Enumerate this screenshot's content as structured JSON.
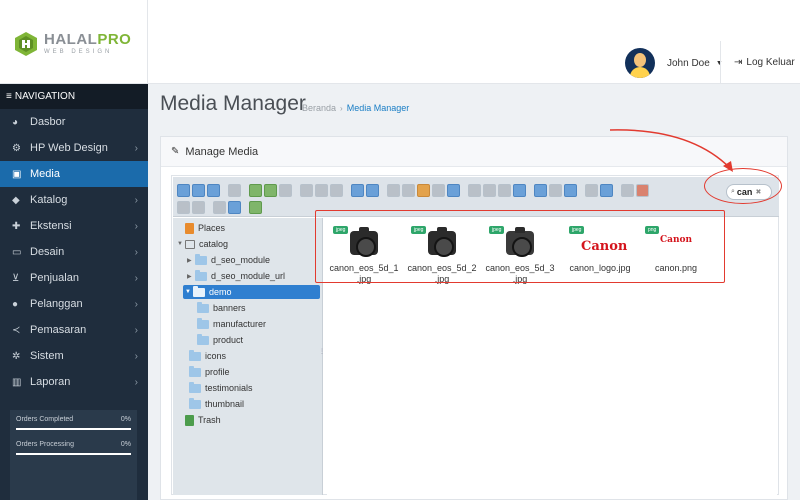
{
  "brand": {
    "name_part1": "HALAL",
    "name_part2": "PRO",
    "tagline": "WEB DESIGN"
  },
  "user": {
    "name": "John Doe",
    "logout_label": "Log Keluar"
  },
  "sidebar": {
    "header": "NAVIGATION",
    "items": [
      {
        "label": "Dasbor",
        "icon": "dashboard-icon",
        "chevron": false
      },
      {
        "label": "HP Web Design",
        "icon": "cogs-icon",
        "chevron": true
      },
      {
        "label": "Media",
        "icon": "image-icon",
        "chevron": false,
        "active": true
      },
      {
        "label": "Katalog",
        "icon": "tag-icon",
        "chevron": true
      },
      {
        "label": "Ekstensi",
        "icon": "puzzle-icon",
        "chevron": true
      },
      {
        "label": "Desain",
        "icon": "monitor-icon",
        "chevron": true
      },
      {
        "label": "Penjualan",
        "icon": "cart-icon",
        "chevron": true
      },
      {
        "label": "Pelanggan",
        "icon": "user-icon",
        "chevron": true
      },
      {
        "label": "Pemasaran",
        "icon": "share-icon",
        "chevron": true
      },
      {
        "label": "Sistem",
        "icon": "gear-icon",
        "chevron": true
      },
      {
        "label": "Laporan",
        "icon": "bar-chart-icon",
        "chevron": true
      }
    ],
    "stats": [
      {
        "label": "Orders Completed",
        "percent": "0%"
      },
      {
        "label": "Orders Processing",
        "percent": "0%"
      }
    ]
  },
  "page": {
    "title": "Media Manager",
    "breadcrumb": {
      "home": "Beranda",
      "current": "Media Manager"
    },
    "panel_title": "Manage Media"
  },
  "search": {
    "value": "can"
  },
  "tree": [
    {
      "label": "Places",
      "kind": "places"
    },
    {
      "label": "catalog",
      "kind": "catalog"
    },
    {
      "label": "d_seo_module",
      "kind": "folder"
    },
    {
      "label": "d_seo_module_url",
      "kind": "folder"
    },
    {
      "label": "demo",
      "kind": "folder",
      "selected": true
    },
    {
      "label": "banners",
      "kind": "folder"
    },
    {
      "label": "manufacturer",
      "kind": "folder"
    },
    {
      "label": "product",
      "kind": "folder"
    },
    {
      "label": "icons",
      "kind": "folder"
    },
    {
      "label": "profile",
      "kind": "folder"
    },
    {
      "label": "testimonials",
      "kind": "folder"
    },
    {
      "label": "thumbnail",
      "kind": "folder"
    },
    {
      "label": "Trash",
      "kind": "trash"
    }
  ],
  "files": [
    {
      "badge": "jpeg",
      "name_line1": "canon_eos_5d_1",
      "name_line2": ".jpg",
      "thumb": "camera"
    },
    {
      "badge": "jpeg",
      "name_line1": "canon_eos_5d_2",
      "name_line2": ".jpg",
      "thumb": "camera"
    },
    {
      "badge": "jpeg",
      "name_line1": "canon_eos_5d_3",
      "name_line2": ".jpg",
      "thumb": "camera"
    },
    {
      "badge": "jpeg",
      "name_line1": "canon_logo.jpg",
      "name_line2": "",
      "thumb": "logo"
    },
    {
      "badge": "png",
      "name_line1": "canon.png",
      "name_line2": "",
      "thumb": "logo-small"
    }
  ],
  "logo_texts": {
    "logo_big": "Canon",
    "logo_small": "Canon"
  },
  "colors": {
    "accent": "#1b6bab",
    "sidebar": "#1f2d3d",
    "annotation": "#e23a2f",
    "brand_green": "#7fb537"
  }
}
